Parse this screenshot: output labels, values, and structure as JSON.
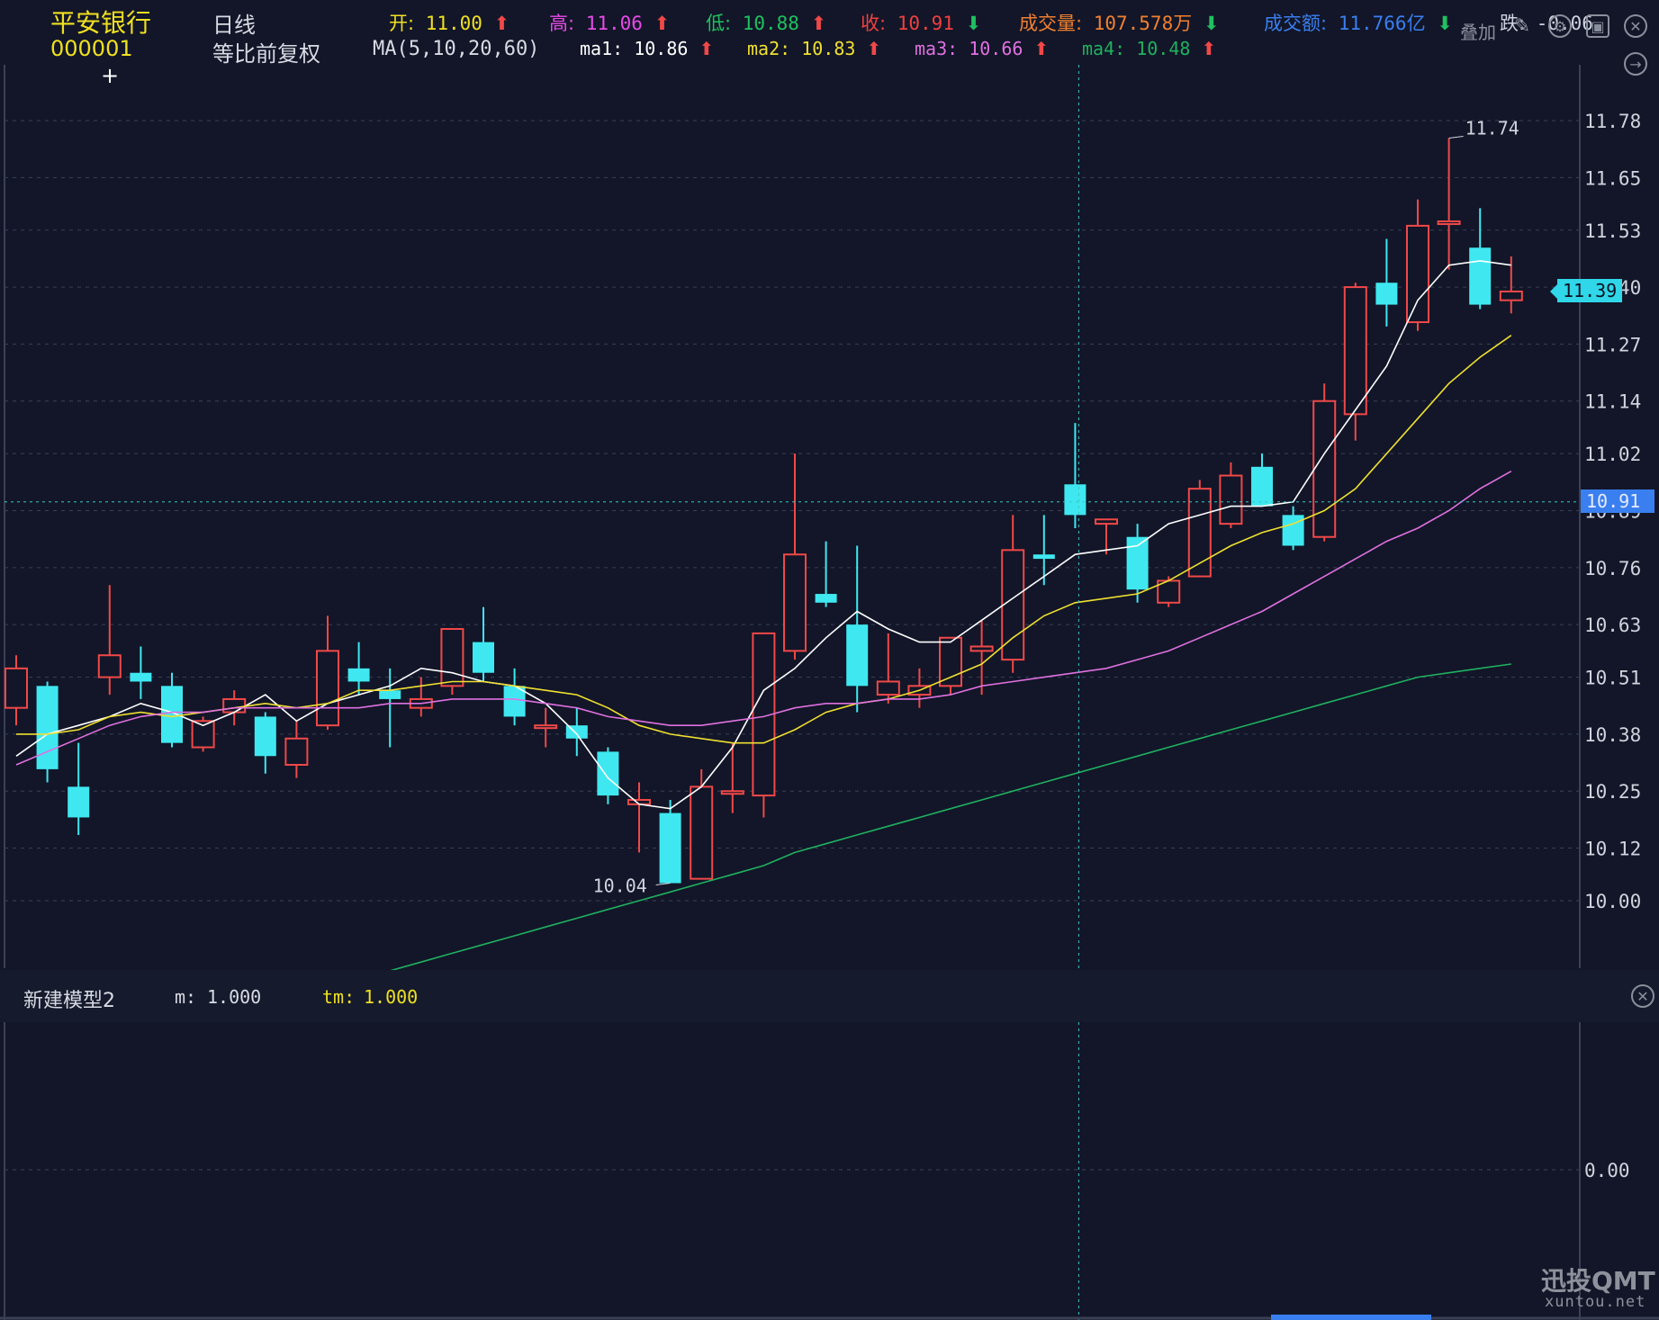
{
  "stock": {
    "name": "平安银行",
    "code": "000001"
  },
  "period": {
    "label": "日线",
    "adjust": "等比前复权"
  },
  "ma_label": "MA(5,10,20,60)",
  "quote": [
    {
      "label": "开:",
      "value": "11.00",
      "arrow": "up",
      "color": "#f0e020"
    },
    {
      "label": "高:",
      "value": "11.06",
      "arrow": "up",
      "color": "#e84be8"
    },
    {
      "label": "低:",
      "value": "10.88",
      "arrow": "up",
      "color": "#20c060"
    },
    {
      "label": "收:",
      "value": "10.91",
      "arrow": "down",
      "color": "#f04040"
    },
    {
      "label": "成交量:",
      "value": "107.578万",
      "arrow": "down",
      "color": "#f08030"
    },
    {
      "label": "成交额:",
      "value": "11.766亿",
      "arrow": "down",
      "color": "#3a7ff0"
    },
    {
      "label": "跌:",
      "value": "-0.06",
      "arrow": "",
      "color": "#cfd3e0"
    }
  ],
  "ma_values": [
    {
      "label": "ma1:",
      "value": "10.86",
      "color": "#ffffff"
    },
    {
      "label": "ma2:",
      "value": "10.83",
      "color": "#f0e030"
    },
    {
      "label": "ma3:",
      "value": "10.66",
      "color": "#e070e0"
    },
    {
      "label": "ma4:",
      "value": "10.48",
      "color": "#20b060"
    }
  ],
  "overlay_label": "叠加",
  "watermark": {
    "brand": "迅投QMT",
    "url": "xuntou.net"
  },
  "sub_panel": {
    "title": "新建模型2",
    "m": {
      "label": "m:",
      "value": "1.000"
    },
    "tm": {
      "label": "tm:",
      "value": "1.000"
    },
    "zero_label": "0.00"
  },
  "current_price_tag": "11.39",
  "cursor_price_tag": "10.91",
  "colors": {
    "up": "#f04848",
    "down": "#3fe8f0",
    "grid": "#3a4055",
    "cursor": "#39c6c6"
  },
  "chart_data": {
    "type": "candlestick",
    "y_ticks": [
      "11.78",
      "11.65",
      "11.53",
      "11.40",
      "11.27",
      "11.14",
      "11.02",
      "10.89",
      "10.76",
      "10.63",
      "10.51",
      "10.38",
      "10.25",
      "10.12",
      "10.00"
    ],
    "ylim": [
      9.85,
      11.85
    ],
    "annotations": [
      {
        "text": "11.74",
        "kind": "high"
      },
      {
        "text": "10.04",
        "kind": "low"
      }
    ],
    "candles": [
      {
        "o": 10.44,
        "h": 10.56,
        "l": 10.4,
        "c": 10.53
      },
      {
        "o": 10.49,
        "h": 10.5,
        "l": 10.27,
        "c": 10.3
      },
      {
        "o": 10.26,
        "h": 10.36,
        "l": 10.15,
        "c": 10.19
      },
      {
        "o": 10.51,
        "h": 10.72,
        "l": 10.47,
        "c": 10.56
      },
      {
        "o": 10.52,
        "h": 10.58,
        "l": 10.46,
        "c": 10.5
      },
      {
        "o": 10.49,
        "h": 10.52,
        "l": 10.35,
        "c": 10.36
      },
      {
        "o": 10.35,
        "h": 10.42,
        "l": 10.34,
        "c": 10.41
      },
      {
        "o": 10.43,
        "h": 10.48,
        "l": 10.4,
        "c": 10.46
      },
      {
        "o": 10.42,
        "h": 10.43,
        "l": 10.29,
        "c": 10.33
      },
      {
        "o": 10.31,
        "h": 10.41,
        "l": 10.28,
        "c": 10.37
      },
      {
        "o": 10.4,
        "h": 10.65,
        "l": 10.39,
        "c": 10.57
      },
      {
        "o": 10.53,
        "h": 10.59,
        "l": 10.47,
        "c": 10.5
      },
      {
        "o": 10.48,
        "h": 10.53,
        "l": 10.35,
        "c": 10.46
      },
      {
        "o": 10.44,
        "h": 10.51,
        "l": 10.42,
        "c": 10.46
      },
      {
        "o": 10.49,
        "h": 10.62,
        "l": 10.47,
        "c": 10.62
      },
      {
        "o": 10.59,
        "h": 10.67,
        "l": 10.5,
        "c": 10.52
      },
      {
        "o": 10.49,
        "h": 10.53,
        "l": 10.4,
        "c": 10.42
      },
      {
        "o": 10.4,
        "h": 10.44,
        "l": 10.35,
        "c": 10.4
      },
      {
        "o": 10.4,
        "h": 10.44,
        "l": 10.33,
        "c": 10.37
      },
      {
        "o": 10.34,
        "h": 10.35,
        "l": 10.22,
        "c": 10.24
      },
      {
        "o": 10.22,
        "h": 10.27,
        "l": 10.11,
        "c": 10.23
      },
      {
        "o": 10.2,
        "h": 10.23,
        "l": 10.04,
        "c": 10.04
      },
      {
        "o": 10.05,
        "h": 10.3,
        "l": 10.05,
        "c": 10.26
      },
      {
        "o": 10.25,
        "h": 10.36,
        "l": 10.2,
        "c": 10.25
      },
      {
        "o": 10.24,
        "h": 10.61,
        "l": 10.19,
        "c": 10.61
      },
      {
        "o": 10.57,
        "h": 11.02,
        "l": 10.55,
        "c": 10.79
      },
      {
        "o": 10.7,
        "h": 10.82,
        "l": 10.67,
        "c": 10.68
      },
      {
        "o": 10.63,
        "h": 10.81,
        "l": 10.43,
        "c": 10.49
      },
      {
        "o": 10.47,
        "h": 10.61,
        "l": 10.45,
        "c": 10.5
      },
      {
        "o": 10.47,
        "h": 10.53,
        "l": 10.44,
        "c": 10.49
      },
      {
        "o": 10.49,
        "h": 10.6,
        "l": 10.47,
        "c": 10.6
      },
      {
        "o": 10.57,
        "h": 10.64,
        "l": 10.47,
        "c": 10.58
      },
      {
        "o": 10.55,
        "h": 10.88,
        "l": 10.52,
        "c": 10.8
      },
      {
        "o": 10.79,
        "h": 10.88,
        "l": 10.72,
        "c": 10.78
      },
      {
        "o": 10.95,
        "h": 11.09,
        "l": 10.85,
        "c": 10.88
      },
      {
        "o": 10.86,
        "h": 10.87,
        "l": 10.79,
        "c": 10.87
      },
      {
        "o": 10.83,
        "h": 10.86,
        "l": 10.68,
        "c": 10.71
      },
      {
        "o": 10.68,
        "h": 10.74,
        "l": 10.67,
        "c": 10.73
      },
      {
        "o": 10.74,
        "h": 10.96,
        "l": 10.74,
        "c": 10.94
      },
      {
        "o": 10.86,
        "h": 11.0,
        "l": 10.85,
        "c": 10.97
      },
      {
        "o": 10.99,
        "h": 11.02,
        "l": 10.9,
        "c": 10.9
      },
      {
        "o": 10.88,
        "h": 10.9,
        "l": 10.8,
        "c": 10.81
      },
      {
        "o": 10.83,
        "h": 11.18,
        "l": 10.82,
        "c": 11.14
      },
      {
        "o": 11.11,
        "h": 11.41,
        "l": 11.05,
        "c": 11.4
      },
      {
        "o": 11.41,
        "h": 11.51,
        "l": 11.31,
        "c": 11.36
      },
      {
        "o": 11.32,
        "h": 11.6,
        "l": 11.3,
        "c": 11.54
      },
      {
        "o": 11.55,
        "h": 11.74,
        "l": 11.44,
        "c": 11.55
      },
      {
        "o": 11.49,
        "h": 11.58,
        "l": 11.35,
        "c": 11.36
      },
      {
        "o": 11.37,
        "h": 11.47,
        "l": 11.34,
        "c": 11.39
      }
    ],
    "ma": {
      "ma1": [
        10.33,
        10.38,
        10.4,
        10.42,
        10.45,
        10.43,
        10.4,
        10.43,
        10.47,
        10.41,
        10.45,
        10.47,
        10.49,
        10.53,
        10.52,
        10.5,
        10.49,
        10.45,
        10.38,
        10.28,
        10.22,
        10.21,
        10.26,
        10.35,
        10.48,
        10.53,
        10.6,
        10.66,
        10.62,
        10.59,
        10.59,
        10.64,
        10.69,
        10.74,
        10.79,
        10.8,
        10.81,
        10.86,
        10.88,
        10.9,
        10.9,
        10.91,
        11.02,
        11.12,
        11.22,
        11.37,
        11.45,
        11.46,
        11.45
      ],
      "ma2": [
        10.38,
        10.38,
        10.39,
        10.42,
        10.43,
        10.42,
        10.43,
        10.44,
        10.45,
        10.44,
        10.45,
        10.48,
        10.48,
        10.49,
        10.5,
        10.5,
        10.49,
        10.48,
        10.47,
        10.44,
        10.4,
        10.38,
        10.37,
        10.36,
        10.36,
        10.39,
        10.43,
        10.45,
        10.46,
        10.48,
        10.51,
        10.54,
        10.6,
        10.65,
        10.68,
        10.69,
        10.7,
        10.73,
        10.77,
        10.81,
        10.84,
        10.86,
        10.89,
        10.94,
        11.02,
        11.1,
        11.18,
        11.24,
        11.29
      ],
      "ma3": [
        10.31,
        10.34,
        10.37,
        10.4,
        10.42,
        10.43,
        10.43,
        10.44,
        10.44,
        10.44,
        10.44,
        10.44,
        10.45,
        10.45,
        10.46,
        10.46,
        10.46,
        10.45,
        10.44,
        10.42,
        10.41,
        10.4,
        10.4,
        10.41,
        10.42,
        10.44,
        10.45,
        10.45,
        10.46,
        10.46,
        10.47,
        10.49,
        10.5,
        10.51,
        10.52,
        10.53,
        10.55,
        10.57,
        10.6,
        10.63,
        10.66,
        10.7,
        10.74,
        10.78,
        10.82,
        10.85,
        10.89,
        10.94,
        10.98
      ],
      "ma4": [
        null,
        null,
        null,
        null,
        null,
        null,
        null,
        null,
        null,
        null,
        null,
        null,
        9.84,
        9.86,
        9.88,
        9.9,
        9.92,
        9.94,
        9.96,
        9.98,
        10.0,
        10.02,
        10.04,
        10.06,
        10.08,
        10.11,
        10.13,
        10.15,
        10.17,
        10.19,
        10.21,
        10.23,
        10.25,
        10.27,
        10.29,
        10.31,
        10.33,
        10.35,
        10.37,
        10.39,
        10.41,
        10.43,
        10.45,
        10.47,
        10.49,
        10.51,
        10.52,
        10.53,
        10.54
      ]
    }
  }
}
